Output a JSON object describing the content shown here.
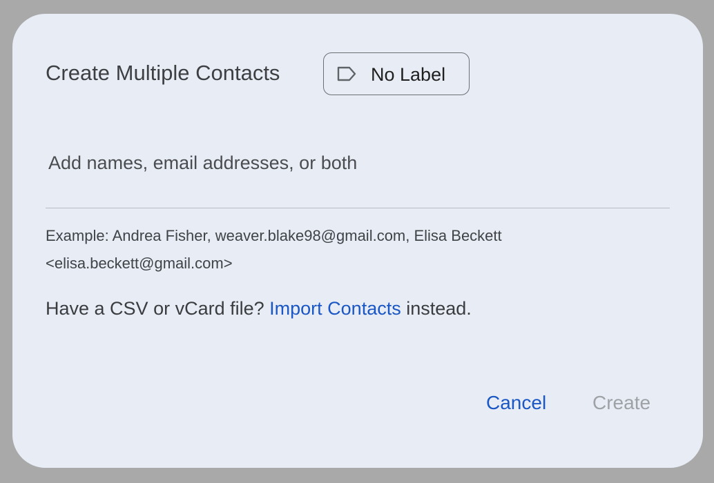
{
  "dialog": {
    "title": "Create Multiple Contacts",
    "label_chip": {
      "icon": "label-icon",
      "text": "No Label"
    },
    "input": {
      "placeholder": "Add names, email addresses, or both",
      "value": ""
    },
    "example_text": "Example: Andrea Fisher, weaver.blake98@gmail.com, Elisa Beckett <elisa.beckett@gmail.com>",
    "import_prompt": {
      "prefix": "Have a CSV or vCard file? ",
      "link": "Import Contacts",
      "suffix": " instead."
    },
    "buttons": {
      "cancel": "Cancel",
      "create": "Create"
    },
    "colors": {
      "dialog_background": "#e8edf5",
      "overlay": "#a9a9a9",
      "link": "#1a56c4",
      "disabled": "#9ea1a6"
    }
  }
}
